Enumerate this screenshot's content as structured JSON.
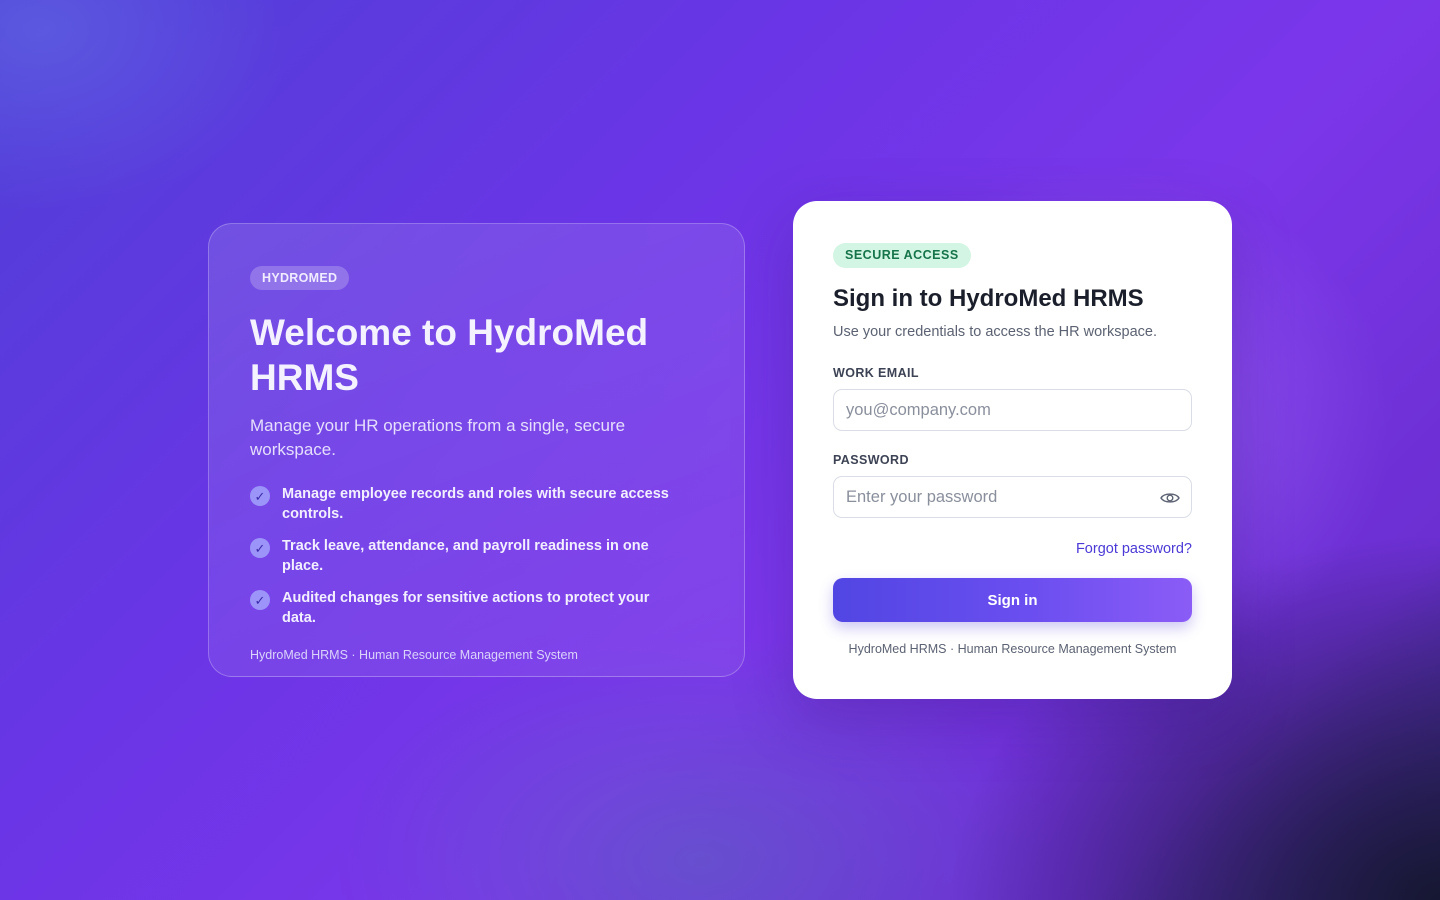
{
  "hero": {
    "badge": "HYDROMED",
    "title": "Welcome to HydroMed HRMS",
    "subtitle": "Manage your HR operations from a single, secure workspace.",
    "features": [
      {
        "icon": "check-icon",
        "text": "Manage employee records and roles with secure access controls."
      },
      {
        "icon": "check-icon",
        "text": "Track leave, attendance, and payroll readiness in one place."
      },
      {
        "icon": "check-icon",
        "text": "Audited changes for sensitive actions to protect your data."
      }
    ],
    "footer": "HydroMed HRMS · Human Resource Management System"
  },
  "login": {
    "badge": "SECURE ACCESS",
    "title": "Sign in to HydroMed HRMS",
    "subtitle": "Use your credentials to access the HR workspace.",
    "email": {
      "label": "WORK EMAIL",
      "value": "",
      "placeholder": "you@company.com"
    },
    "password": {
      "label": "PASSWORD",
      "value": "",
      "placeholder": "Enter your password",
      "toggle_icon": "eye-icon"
    },
    "forgot_label": "Forgot password?",
    "submit_label": "Sign in",
    "footer": "HydroMed HRMS · Human Resource Management System"
  },
  "colors": {
    "accent": "#5146e3",
    "link": "#4b3ad6",
    "secure_badge_bg": "#d3f5e3",
    "secure_badge_text": "#16744a"
  }
}
